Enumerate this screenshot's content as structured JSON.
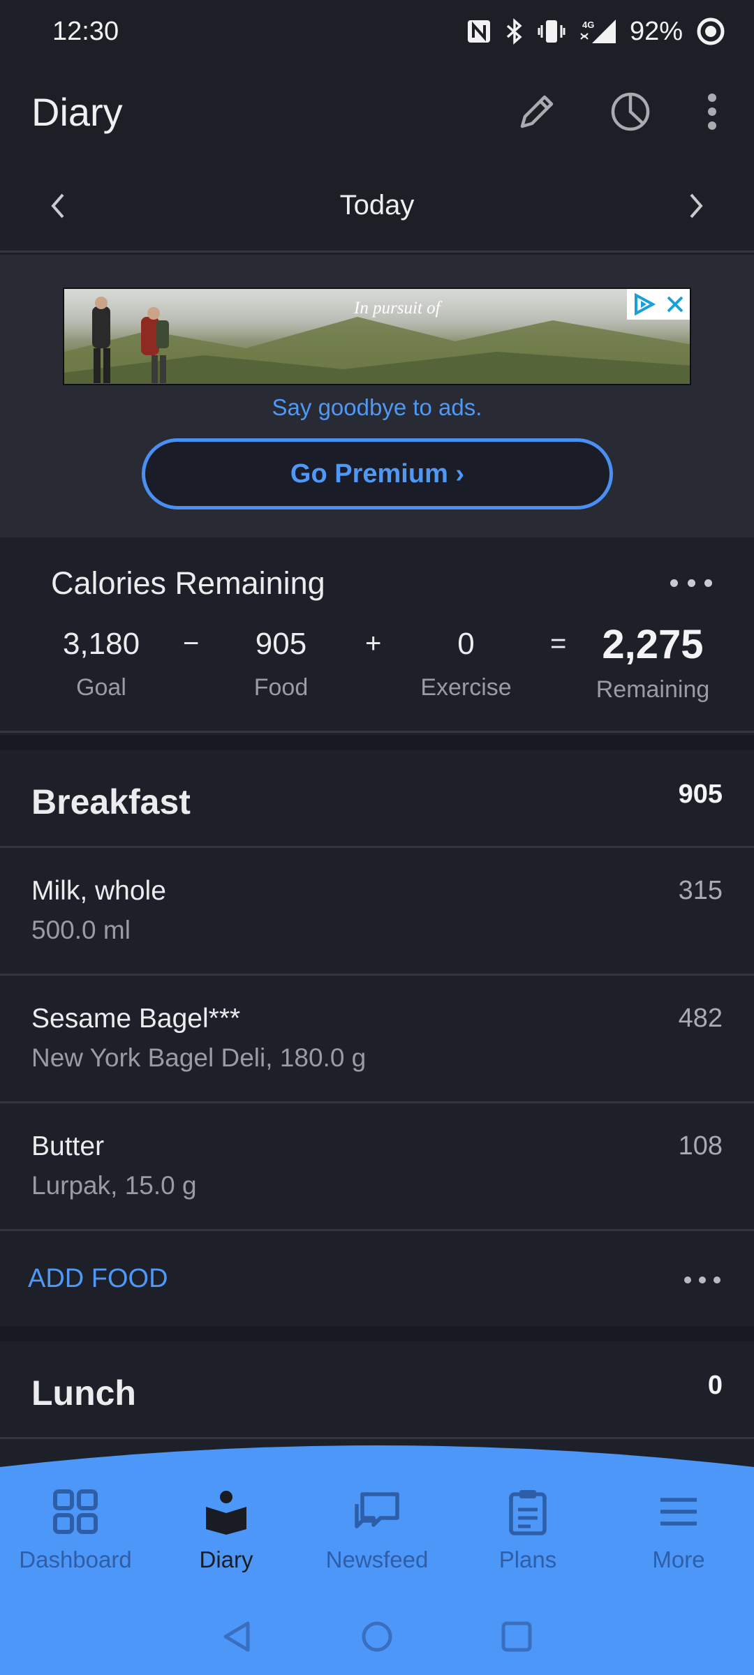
{
  "status_bar": {
    "time": "12:30",
    "battery": "92%",
    "network": "4G"
  },
  "header": {
    "title": "Diary"
  },
  "date_nav": {
    "label": "Today"
  },
  "ad": {
    "banner_text": "In pursuit of",
    "say_goodbye": "Say goodbye to ads.",
    "premium_button": "Go Premium ›"
  },
  "calories": {
    "title": "Calories Remaining",
    "goal": {
      "value": "3,180",
      "label": "Goal"
    },
    "minus": "−",
    "food": {
      "value": "905",
      "label": "Food"
    },
    "plus": "+",
    "exercise": {
      "value": "0",
      "label": "Exercise"
    },
    "equals": "=",
    "remaining": {
      "value": "2,275",
      "label": "Remaining"
    }
  },
  "breakfast": {
    "name": "Breakfast",
    "total": "905",
    "items": [
      {
        "name": "Milk, whole",
        "desc": "500.0 ml",
        "cal": "315"
      },
      {
        "name": "Sesame Bagel***",
        "desc": "New York Bagel Deli, 180.0 g",
        "cal": "482"
      },
      {
        "name": "Butter",
        "desc": "Lurpak, 15.0 g",
        "cal": "108"
      }
    ],
    "add_food": "ADD FOOD"
  },
  "lunch": {
    "name": "Lunch",
    "total": "0"
  },
  "bottom_nav": {
    "items": [
      {
        "label": "Dashboard",
        "icon": "dashboard-icon"
      },
      {
        "label": "Diary",
        "icon": "diary-icon"
      },
      {
        "label": "Newsfeed",
        "icon": "newsfeed-icon"
      },
      {
        "label": "Plans",
        "icon": "plans-icon"
      },
      {
        "label": "More",
        "icon": "menu-icon"
      }
    ],
    "active": "Diary"
  },
  "colors": {
    "accent": "#4a90f2",
    "nav_bg": "#4d97f8",
    "background": "#1e2029"
  }
}
